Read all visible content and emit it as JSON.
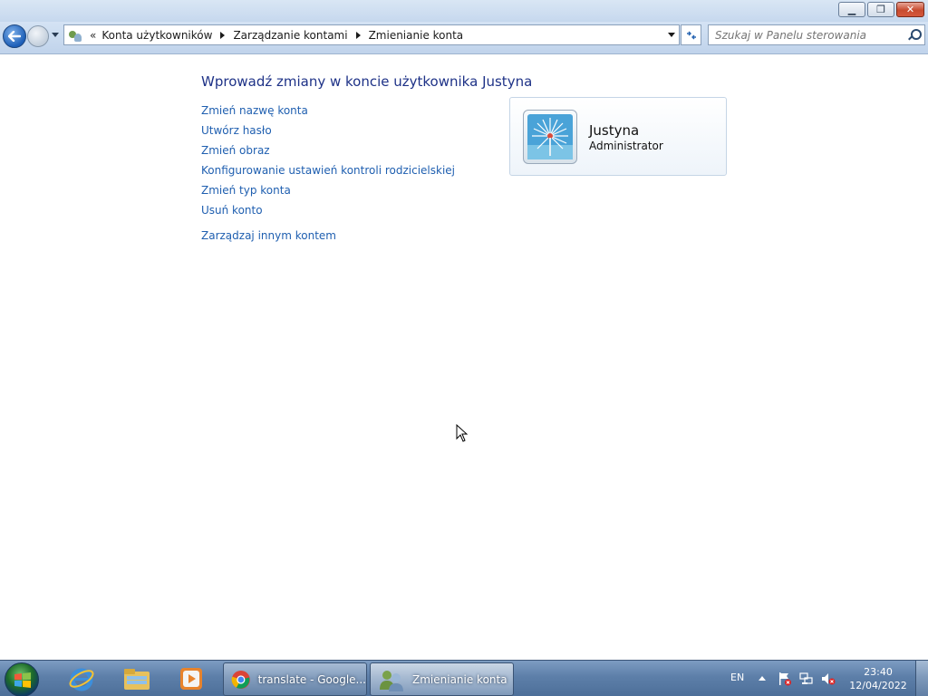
{
  "window": {
    "minimize_icon": "minimize-icon",
    "maximize_icon": "restore-icon",
    "close_icon": "close-icon"
  },
  "navigation": {
    "breadcrumb_prefix": "«",
    "breadcrumbs": [
      "Konta użytkowników",
      "Zarządzanie kontami",
      "Zmienianie konta"
    ],
    "search_placeholder": "Szukaj w Panelu sterowania"
  },
  "content": {
    "title": "Wprowadź zmiany w koncie użytkownika Justyna",
    "tasks": [
      "Zmień nazwę konta",
      "Utwórz hasło",
      "Zmień obraz",
      "Konfigurowanie ustawień kontroli rodzicielskiej",
      "Zmień typ konta",
      "Usuń konto"
    ],
    "manage_other": "Zarządzaj innym kontem",
    "account": {
      "name": "Justyna",
      "type": "Administrator",
      "picture_icon": "windmill-picture-icon"
    }
  },
  "taskbar": {
    "tasks": [
      {
        "label": "translate - Google...",
        "icon": "chrome-icon"
      },
      {
        "label": "Zmienianie konta",
        "icon": "user-accounts-icon"
      }
    ],
    "language": "EN",
    "time": "23:40",
    "date": "12/04/2022"
  },
  "colors": {
    "link": "#1f5fb0",
    "title": "#1e3287",
    "taskbar": "#5d7fa9"
  }
}
